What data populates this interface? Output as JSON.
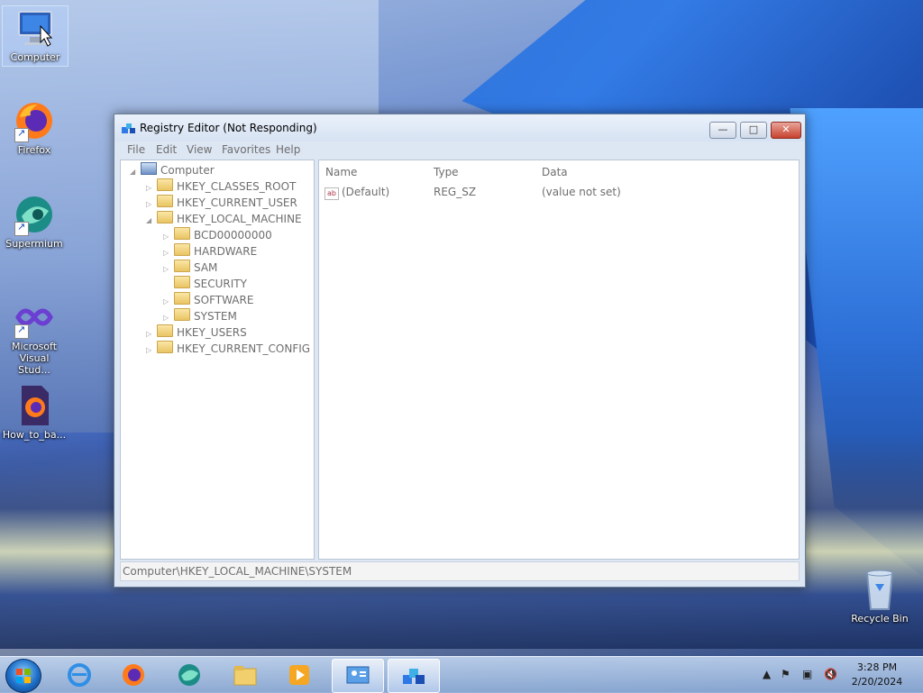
{
  "desktop": {
    "icons": [
      {
        "label": "Computer"
      },
      {
        "label": "Firefox"
      },
      {
        "label": "Supermium"
      },
      {
        "label": "Microsoft Visual Stud..."
      },
      {
        "label": "How_to_ba..."
      }
    ],
    "recycle_bin": {
      "label": "Recycle Bin"
    }
  },
  "window": {
    "title": "Registry Editor (Not Responding)",
    "controls": {
      "minimize": "—",
      "maximize": "□",
      "close": "✕"
    },
    "menu": [
      "File",
      "Edit",
      "View",
      "Favorites",
      "Help"
    ],
    "tree": {
      "root": "Computer",
      "keys": [
        {
          "label": "HKEY_CLASSES_ROOT"
        },
        {
          "label": "HKEY_CURRENT_USER"
        },
        {
          "label": "HKEY_LOCAL_MACHINE"
        },
        {
          "label": "BCD00000000"
        },
        {
          "label": "HARDWARE"
        },
        {
          "label": "SAM"
        },
        {
          "label": "SECURITY"
        },
        {
          "label": "SOFTWARE"
        },
        {
          "label": "SYSTEM"
        },
        {
          "label": "HKEY_USERS"
        },
        {
          "label": "HKEY_CURRENT_CONFIG"
        }
      ]
    },
    "list": {
      "headers": {
        "name": "Name",
        "type": "Type",
        "data": "Data"
      },
      "rows": [
        {
          "name": "(Default)",
          "type": "REG_SZ",
          "data": "(value not set)"
        }
      ]
    },
    "status_path": "Computer\\HKEY_LOCAL_MACHINE\\SYSTEM"
  },
  "taskbar": {
    "clock_time": "3:28 PM",
    "clock_date": "2/20/2024"
  },
  "colors": {
    "accent": "#2f79e6",
    "close_button": "#c7412e"
  }
}
